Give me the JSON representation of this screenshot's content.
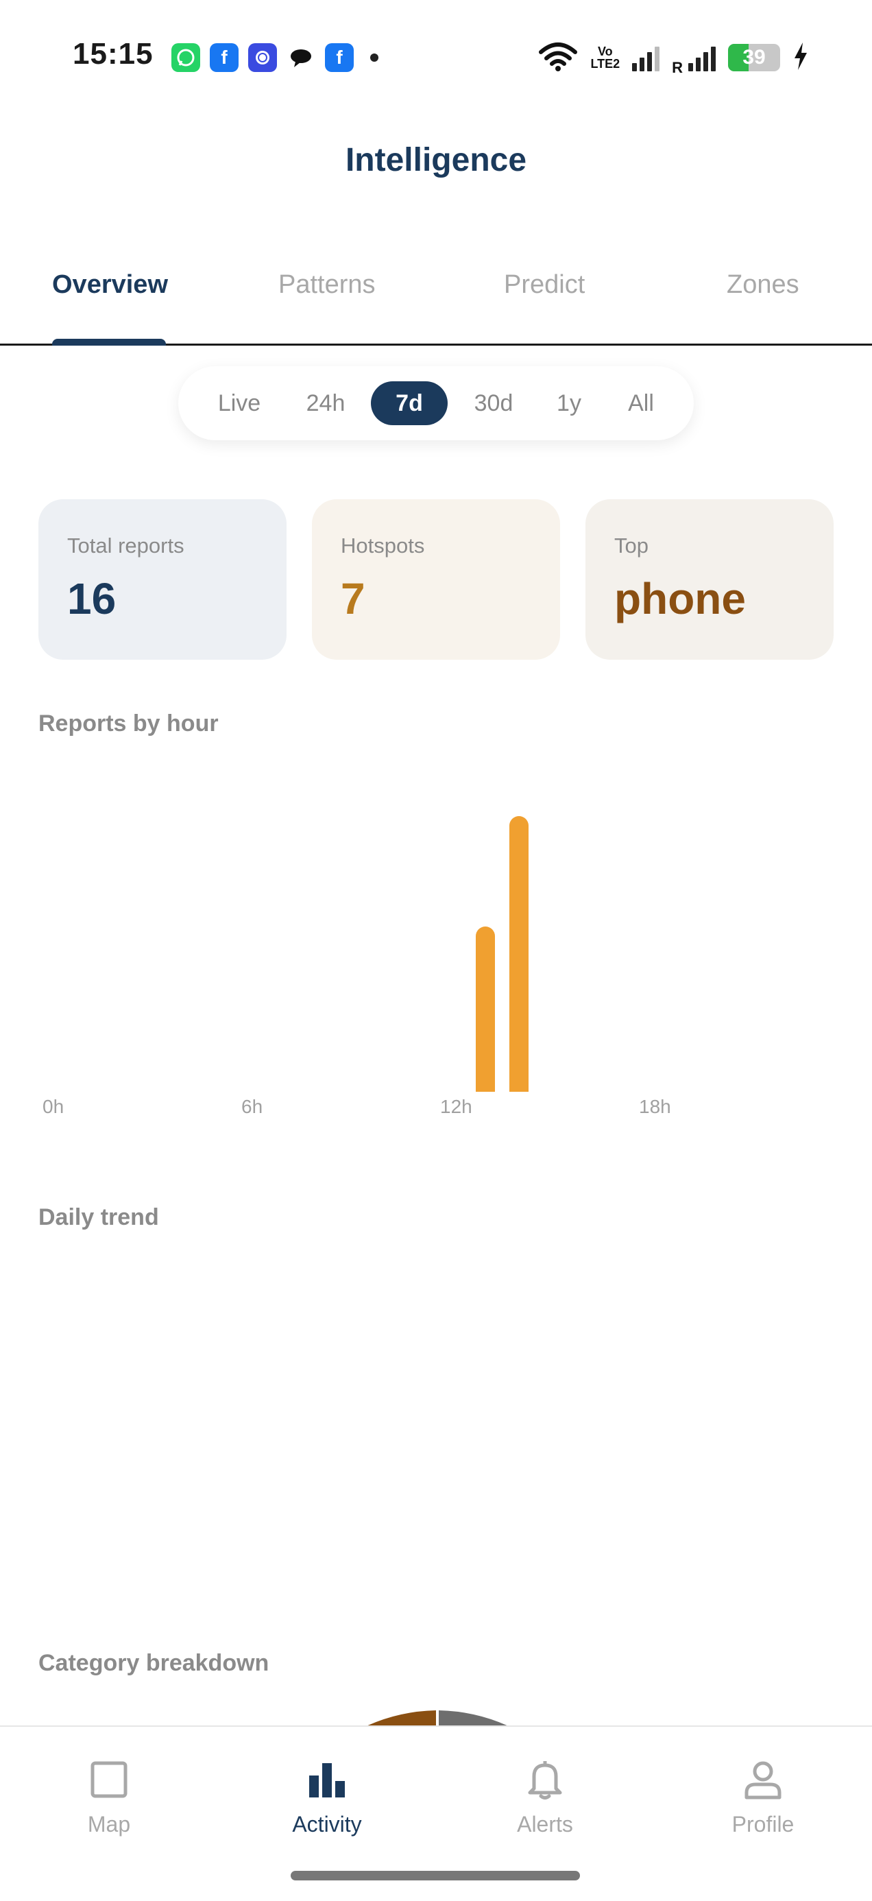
{
  "status_bar": {
    "time": "15:15",
    "notification_icons": [
      "whatsapp-icon",
      "facebook-icon",
      "signal-icon",
      "chat-icon",
      "facebook-icon"
    ],
    "network": {
      "volte_top": "Vo",
      "volte_bottom": "LTE2",
      "roaming": "R"
    },
    "battery_level": "39",
    "charging": true
  },
  "header": {
    "title": "Intelligence"
  },
  "tabs": [
    {
      "label": "Overview",
      "active": true
    },
    {
      "label": "Patterns",
      "active": false
    },
    {
      "label": "Predict",
      "active": false
    },
    {
      "label": "Zones",
      "active": false
    }
  ],
  "time_range": {
    "options": [
      "Live",
      "24h",
      "7d",
      "30d",
      "1y",
      "All"
    ],
    "selected": "7d"
  },
  "stats": {
    "total_reports": {
      "label": "Total reports",
      "value": "16"
    },
    "hotspots": {
      "label": "Hotspots",
      "value": "7"
    },
    "top": {
      "label": "Top",
      "value": "phone"
    }
  },
  "sections": {
    "reports_by_hour": "Reports by hour",
    "daily_trend": "Daily trend",
    "category_breakdown": "Category breakdown"
  },
  "chart_data": {
    "type": "bar",
    "x_tick_labels": [
      "0h",
      "6h",
      "12h",
      "18h"
    ],
    "hours": [
      13,
      14
    ],
    "values": [
      6,
      10
    ],
    "xlim": [
      0,
      24
    ],
    "ylim": [
      0,
      10
    ],
    "bar_color": "#f0a030"
  },
  "category_breakdown_colors": [
    "#8a4f12",
    "#6e6e6e"
  ],
  "bottom_nav": [
    {
      "label": "Map",
      "icon": "map-icon",
      "active": false
    },
    {
      "label": "Activity",
      "icon": "activity-icon",
      "active": true
    },
    {
      "label": "Alerts",
      "icon": "bell-icon",
      "active": false
    },
    {
      "label": "Profile",
      "icon": "profile-icon",
      "active": false
    }
  ],
  "colors": {
    "primary": "#1b3a5c",
    "accent": "#f0a030",
    "hotspot": "#b87a1e",
    "top": "#8a4f12"
  }
}
